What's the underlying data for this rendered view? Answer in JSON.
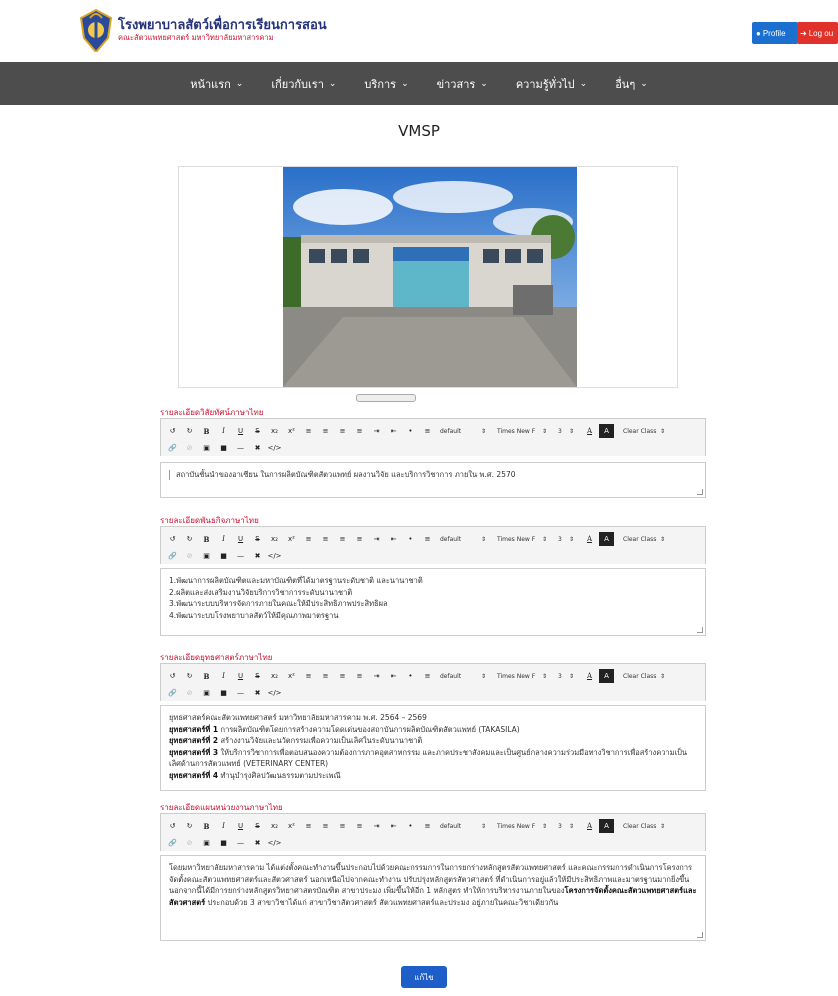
{
  "header": {
    "title": "โรงพยาบาลสัตว์เพื่อการเรียนการสอน",
    "subtitle": "คณะสัตวแพทยศาสตร์ มหาวิทยาลัยมหาสารคาม",
    "profile_label": "Profile",
    "logout_label": "Log ou"
  },
  "nav": {
    "items": [
      {
        "label": "หน้าแรก"
      },
      {
        "label": "เกี่ยวกับเรา"
      },
      {
        "label": "บริการ"
      },
      {
        "label": "ข่าวสาร"
      },
      {
        "label": "ความรู้ทั่วไป"
      },
      {
        "label": "อื่นๆ"
      }
    ]
  },
  "page": {
    "title": "VMSP"
  },
  "toolbar": {
    "size_default": "default",
    "font_name": "Times New F",
    "font_size": "3",
    "clear_class": "Clear Class"
  },
  "sections": {
    "vision": {
      "label": "รายละเอียดวิสัยทัศน์ภาษาไทย",
      "text": "สถาบันชั้นนำของอาเซียน ในการผลิตบัณฑิตสัตวแพทย์ ผลงานวิจัย และบริการวิชาการ ภายใน พ.ศ. 2570"
    },
    "mission": {
      "label": "รายละเอียดพันธกิจภาษาไทย",
      "lines": [
        "1.พัฒนาการผลิตบัณฑิตและมหาบัณฑิตที่ได้มาตรฐานระดับชาติ และนานาชาติ",
        "2.ผลิตและส่งเสริมงานวิจัยบริการวิชาการระดับนานาชาติ",
        "3.พัฒนาระบบบริหารจัดการภายในคณะให้มีประสิทธิภาพประสิทธิผล",
        "4.พัฒนาระบบโรงพยาบาลสัตว์ให้มีคุณภาพมาตรฐาน"
      ]
    },
    "strategy": {
      "label": "รายละเอียดยุทธศาสตร์ภาษาไทย",
      "intro": "ยุทธศาสตร์คณะสัตวแพทยศาสตร์ มหาวิทยาลัยมหาสารคาม พ.ศ. 2564 – 2569",
      "items": [
        {
          "head": "ยุทธศาสตร์ที่ 1",
          "text": " การผลิตบัณฑิตโดยการสร้างความโดดเด่นของสถาบันการผลิตบัณฑิตสัตวแพทย์ (TAKASILA)"
        },
        {
          "head": "ยุทธศาสตร์ที่ 2",
          "text": " สร้างงานวิจัยและนวัตกรรมเพื่อความเป็นเลิศในระดับนานาชาติ"
        },
        {
          "head": "ยุทธศาสตร์ที่ 3",
          "text": " ให้บริการวิชาการเพื่อตอบสนองความต้องการภาคอุตสาหกรรม และภาคประชาสังคมและเป็นศูนย์กลางความร่วมมือทางวิชาการเพื่อสร้างความเป็นเลิศด้านการสัตวแพทย์ (VETERINARY CENTER)"
        },
        {
          "head": "ยุทธศาสตร์ที่ 4",
          "text": " ทำนุบำรุงศิลปวัฒนธรรมตามประเพณี"
        }
      ]
    },
    "unit_plan": {
      "label": "รายละเอียดแผนหน่วยงานภาษาไทย",
      "text_a": "โดยมหาวิทยาลัยมหาสารคาม ได้แต่งตั้งคณะทำงานขึ้นประกอบไปด้วยคณะกรรมการในการยกร่างหลักสูตรสัตวแพทยศาสตร์ และคณะกรรมการดำเนินการโครงการจัดตั้งคณะสัตวแพทยศาสตร์และสัตวศาสตร์ นอกเหนือไปจากคณะทำงาน ปรับปรุงหลักสูตรสัตวศาสตร์ ที่ดำเนินการอยู่แล้วให้มีประสิทธิภาพและมาตรฐานมากยิ่งขึ้น นอกจากนี้ได้มีการยกร่างหลักสูตรวิทยาศาสตรบัณฑิต สาขาประมง เพิ่มขึ้นให้อีก 1 หลักสูตร ทำให้การบริหารงานภายในของ",
      "bold": "โครงการจัดตั้งคณะสัตวแพทยศาสตร์และสัตวศาสตร์",
      "text_b": " ประกอบด้วย 3 สาขาวิชาได้แก่ สาขาวิชาสัตวศาสตร์ สัตวแพทยศาสตร์และประมง อยู่ภายในคณะวิชาเดียวกัน"
    }
  },
  "submit_label": "แก้ไข",
  "colors": {
    "nav_bg": "#4d4d4d",
    "label_red": "#c8102e",
    "profile_blue": "#1a6fcf",
    "logout_red": "#e0312b",
    "submit_blue": "#1d5ec8"
  }
}
